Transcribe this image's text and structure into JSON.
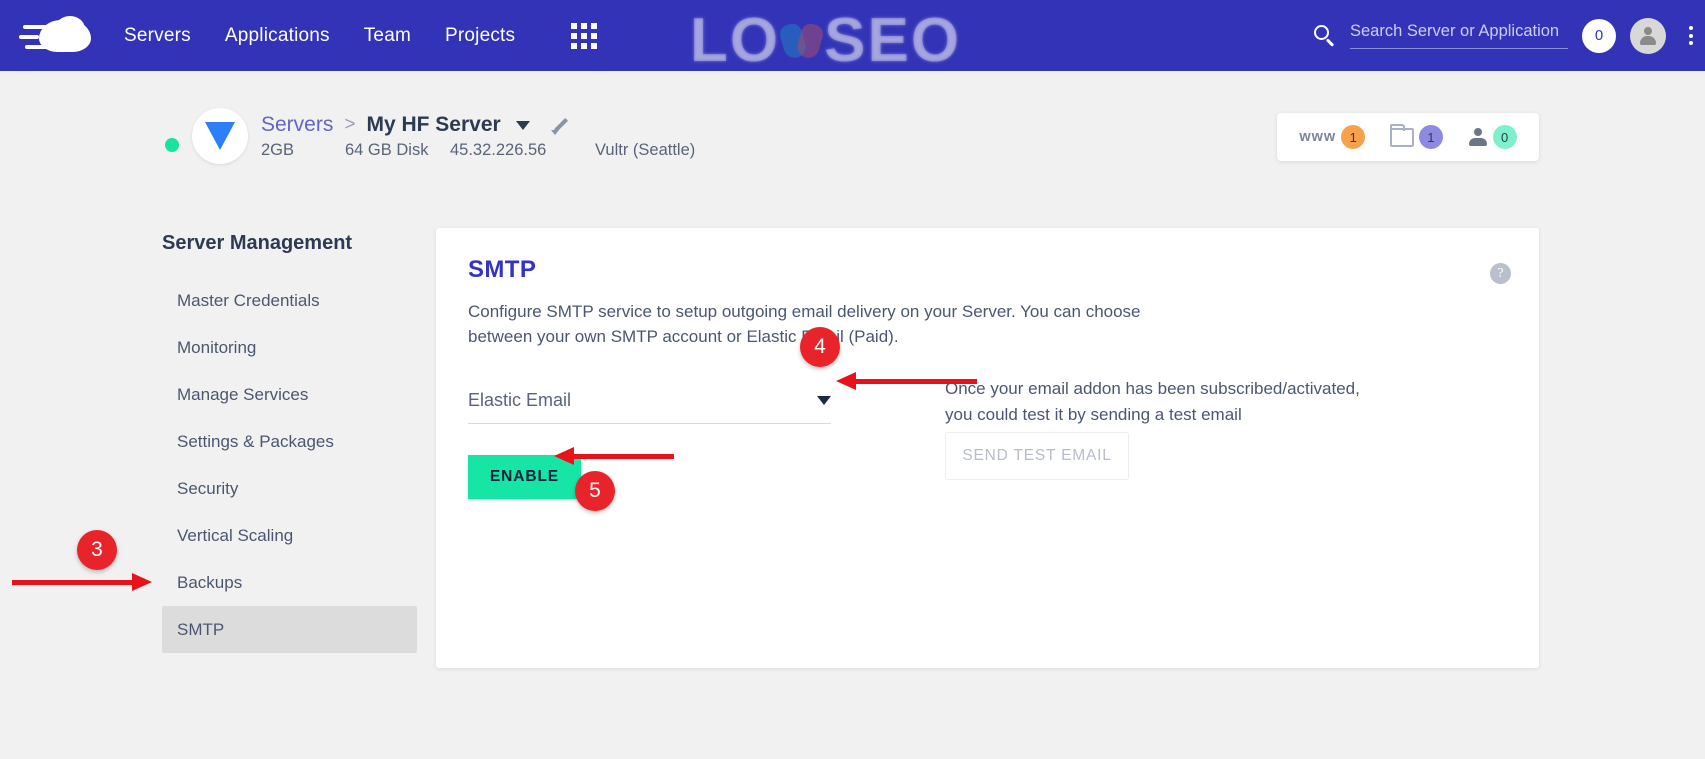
{
  "topnav": {
    "logo_name": "cloudways-cloud-logo",
    "links": [
      {
        "label": "Servers"
      },
      {
        "label": "Applications"
      },
      {
        "label": "Team"
      },
      {
        "label": "Projects"
      }
    ],
    "grid_icon": "apps-grid-icon",
    "plus_label": "+",
    "search": {
      "placeholder": "Search Server or Application",
      "value": ""
    },
    "notification_count": "0",
    "avatar_icon": "user-avatar-icon",
    "kebab_icon": "more-vertical-icon"
  },
  "watermark": {
    "left_text": "LO",
    "right_text": "SEO"
  },
  "server": {
    "status": "online",
    "provider_icon": "vultr-logo-icon",
    "breadcrumb_root": "Servers",
    "breadcrumb_sep": ">",
    "name": "My HF Server",
    "ram": "2GB",
    "disk": "64 GB Disk",
    "ip": "45.32.226.56",
    "provider_location": "Vultr (Seattle)",
    "counters": [
      {
        "label": "www",
        "icon": "www-label-icon",
        "value": "1",
        "color": "#f5a24b"
      },
      {
        "label": "",
        "icon": "folder-icon",
        "value": "1",
        "color": "#8d8ae0"
      },
      {
        "label": "",
        "icon": "person-icon",
        "value": "0",
        "color": "#7ef0cc"
      }
    ]
  },
  "sidebar": {
    "title": "Server Management",
    "items": [
      {
        "label": "Master Credentials",
        "active": false
      },
      {
        "label": "Monitoring",
        "active": false
      },
      {
        "label": "Manage Services",
        "active": false
      },
      {
        "label": "Settings & Packages",
        "active": false
      },
      {
        "label": "Security",
        "active": false
      },
      {
        "label": "Vertical Scaling",
        "active": false
      },
      {
        "label": "Backups",
        "active": false
      },
      {
        "label": "SMTP",
        "active": true
      }
    ]
  },
  "card": {
    "title": "SMTP",
    "help_icon": "help-question-icon",
    "description": "Configure SMTP service to setup outgoing email delivery on your Server. You can choose between your own SMTP account or Elastic Email (Paid).",
    "select_value": "Elastic Email",
    "enable_label": "ENABLE",
    "hint": "Once your email addon has been subscribed/activated, you could test it by sending a test email",
    "send_test_label": "SEND TEST EMAIL"
  },
  "annotations": [
    {
      "number": "3"
    },
    {
      "number": "4"
    },
    {
      "number": "5"
    }
  ],
  "colors": {
    "nav_blue": "#3333b8",
    "accent_green": "#17e5a6",
    "annotation_red": "#e8242a",
    "page_bg": "#f1f1f1",
    "title_blue": "#3434c4"
  }
}
